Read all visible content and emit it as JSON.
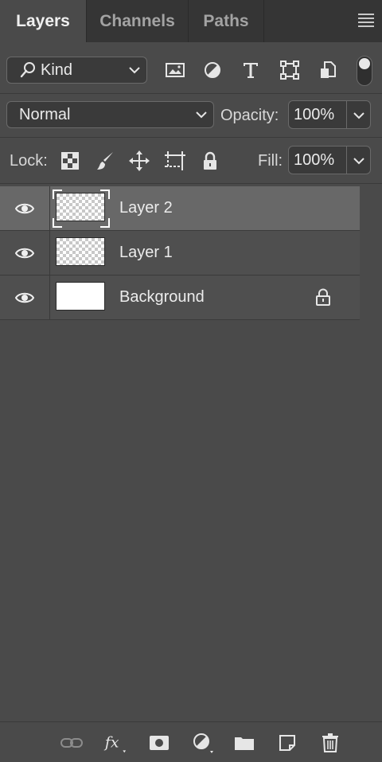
{
  "tabs": [
    {
      "label": "Layers",
      "active": true
    },
    {
      "label": "Channels",
      "active": false
    },
    {
      "label": "Paths",
      "active": false
    }
  ],
  "panel_menu_icon": "hamburger-menu-icon",
  "filter": {
    "kind_label": "Kind",
    "search_icon": "search-icon",
    "filter_icons": [
      "image-filter-icon",
      "adjustment-filter-icon",
      "type-filter-icon",
      "shape-filter-icon",
      "smart-object-filter-icon"
    ],
    "toggle_on": true
  },
  "blend": {
    "mode": "Normal",
    "opacity_label": "Opacity:",
    "opacity_value": "100%"
  },
  "lock": {
    "label": "Lock:",
    "icons": [
      "lock-transparent-pixels-icon",
      "lock-image-pixels-icon",
      "lock-position-icon",
      "lock-artboard-icon",
      "lock-all-icon"
    ],
    "fill_label": "Fill:",
    "fill_value": "100%"
  },
  "layers": [
    {
      "name": "Layer 2",
      "visible": true,
      "selected": true,
      "thumb": "transparent",
      "locked": false
    },
    {
      "name": "Layer 1",
      "visible": true,
      "selected": false,
      "thumb": "transparent",
      "locked": false
    },
    {
      "name": "Background",
      "visible": true,
      "selected": false,
      "thumb": "white",
      "locked": true
    }
  ],
  "footer_icons": [
    "link-layers-icon",
    "layer-style-fx-icon",
    "add-mask-icon",
    "adjustment-layer-icon",
    "new-group-folder-icon",
    "new-layer-icon",
    "delete-trash-icon"
  ],
  "colors": {
    "panel_bg": "#4a4a4a",
    "tab_bar_bg": "#353535",
    "selected_layer_bg": "#686868",
    "field_bg": "#3a3a3a"
  }
}
